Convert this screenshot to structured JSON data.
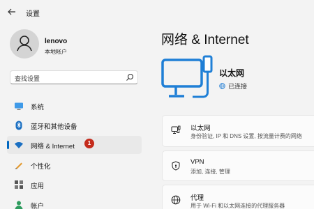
{
  "window": {
    "title": "设置",
    "back_icon": "arrow-left-icon"
  },
  "user": {
    "name": "lenovo",
    "account_type": "本地帐户"
  },
  "search": {
    "placeholder": "查找设置"
  },
  "sidebar": {
    "items": [
      {
        "label": "系统",
        "icon": "monitor-icon",
        "active": false
      },
      {
        "label": "蓝牙和其他设备",
        "icon": "bluetooth-icon",
        "active": false
      },
      {
        "label": "网络 & Internet",
        "icon": "wifi-icon",
        "active": true,
        "badge": "1"
      },
      {
        "label": "个性化",
        "icon": "pencil-icon",
        "active": false
      },
      {
        "label": "应用",
        "icon": "apps-icon",
        "active": false
      },
      {
        "label": "帐户",
        "icon": "person-icon",
        "active": false
      }
    ]
  },
  "main": {
    "title": "网络 & Internet",
    "hero": {
      "name": "以太网",
      "status": "已连接"
    },
    "cards": [
      {
        "title": "以太网",
        "subtitle": "身份验证, IP 和 DNS 设置, 按流量计费的网络",
        "icon": "ethernet-icon"
      },
      {
        "title": "VPN",
        "subtitle": "添加, 连接, 管理",
        "icon": "shield-icon"
      },
      {
        "title": "代理",
        "subtitle": "用于 Wi-Fi 和以太网连接的代理服务器",
        "icon": "globe-icon"
      }
    ]
  },
  "colors": {
    "accent": "#0067c0",
    "badge": "#c42b1c",
    "hero_icon": "#1f7fd6"
  }
}
